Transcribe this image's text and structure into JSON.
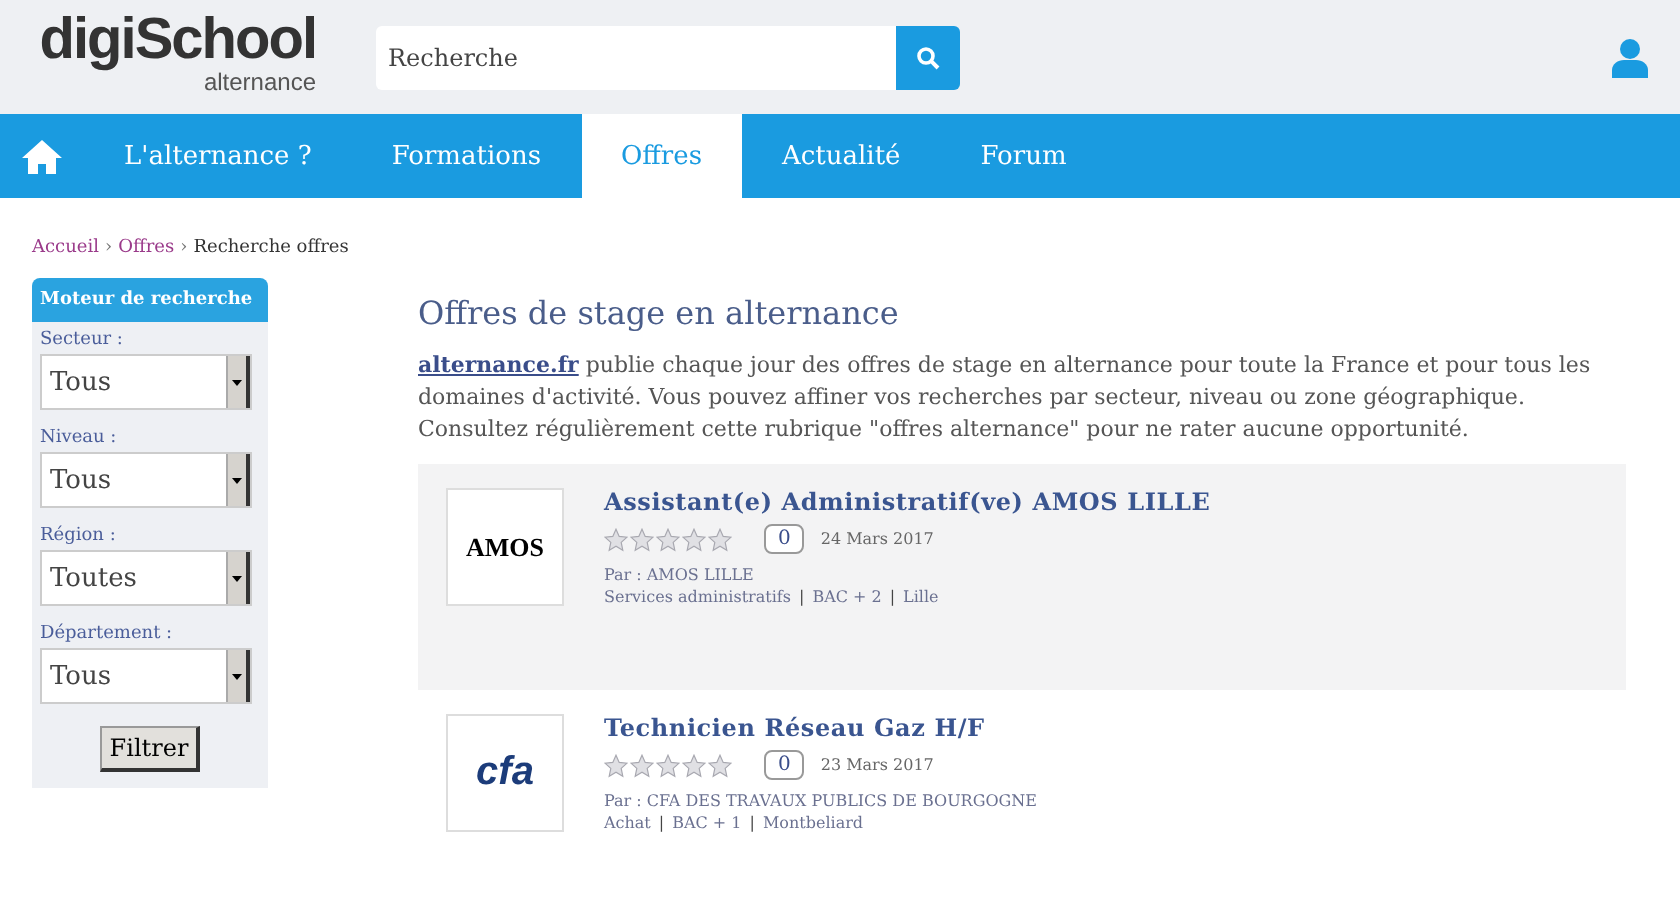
{
  "header": {
    "logo": {
      "name": "digiSchool",
      "sub": "alternance"
    },
    "search": {
      "placeholder": "Recherche"
    }
  },
  "nav": [
    {
      "label": "L'alternance ?",
      "selected": false
    },
    {
      "label": "Formations",
      "selected": false
    },
    {
      "label": "Offres",
      "selected": true
    },
    {
      "label": "Actualité",
      "selected": false
    },
    {
      "label": "Forum",
      "selected": false
    }
  ],
  "breadcrumb_separator": "›",
  "breadcrumb": [
    {
      "label": "Accueil",
      "link": true
    },
    {
      "label": "Offres",
      "link": true
    },
    {
      "label": "Recherche offres",
      "link": false
    }
  ],
  "sidebar": {
    "title": "Moteur de recherche",
    "filters": [
      {
        "label": "Secteur :",
        "value": "Tous"
      },
      {
        "label": "Niveau :",
        "value": "Tous"
      },
      {
        "label": "Région :",
        "value": "Toutes"
      },
      {
        "label": "Département :",
        "value": "Tous"
      }
    ],
    "button": "Filtrer"
  },
  "main": {
    "title": "Offres de stage en alternance",
    "intro_link": "alternance.fr",
    "intro": " publie chaque jour des offres de stage en alternance pour toute la France et pour tous les domaines d'activité. Vous pouvez affiner vos recherches par secteur, niveau ou zone géographique. Consultez régulièrement cette rubrique \"offres alternance\" pour ne rater aucune opportunité.",
    "tag_separator": "|",
    "offers": [
      {
        "logo": "AMOS",
        "title": "Assistant(e) Administratif(ve) AMOS LILLE",
        "stars": 0,
        "comments": "0",
        "date": "24 Mars 2017",
        "by": "Par : AMOS LILLE",
        "tags": [
          "Services administratifs",
          "BAC + 2",
          "Lille"
        ],
        "selected": true
      },
      {
        "logo": "cfa",
        "title": "Technicien Réseau Gaz H/F",
        "stars": 0,
        "comments": "0",
        "date": "23 Mars 2017",
        "by": "Par : CFA DES TRAVAUX PUBLICS DE BOURGOGNE",
        "tags": [
          "Achat",
          "BAC + 1",
          "Montbeliard"
        ],
        "selected": false
      }
    ]
  }
}
